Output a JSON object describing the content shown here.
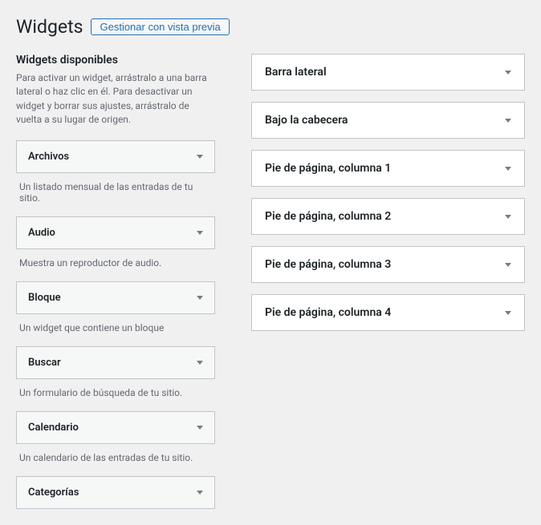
{
  "header": {
    "title": "Widgets",
    "preview_button": "Gestionar con vista previa"
  },
  "available": {
    "title": "Widgets disponibles",
    "help": "Para activar un widget, arrástralo a una barra lateral o haz clic en él. Para desactivar un widget y borrar sus ajustes, arrástralo de vuelta a su lugar de origen."
  },
  "widgets": [
    {
      "name": "Archivos",
      "desc": "Un listado mensual de las entradas de tu sitio."
    },
    {
      "name": "Audio",
      "desc": "Muestra un reproductor de audio."
    },
    {
      "name": "Bloque",
      "desc": "Un widget que contiene un bloque"
    },
    {
      "name": "Buscar",
      "desc": "Un formulario de búsqueda de tu sitio."
    },
    {
      "name": "Calendario",
      "desc": "Un calendario de las entradas de tu sitio."
    },
    {
      "name": "Categorías",
      "desc": ""
    }
  ],
  "areas": [
    {
      "name": "Barra lateral"
    },
    {
      "name": "Bajo la cabecera"
    },
    {
      "name": "Pie de página, columna 1"
    },
    {
      "name": "Pie de página, columna 2"
    },
    {
      "name": "Pie de página, columna 3"
    },
    {
      "name": "Pie de página, columna 4"
    }
  ]
}
